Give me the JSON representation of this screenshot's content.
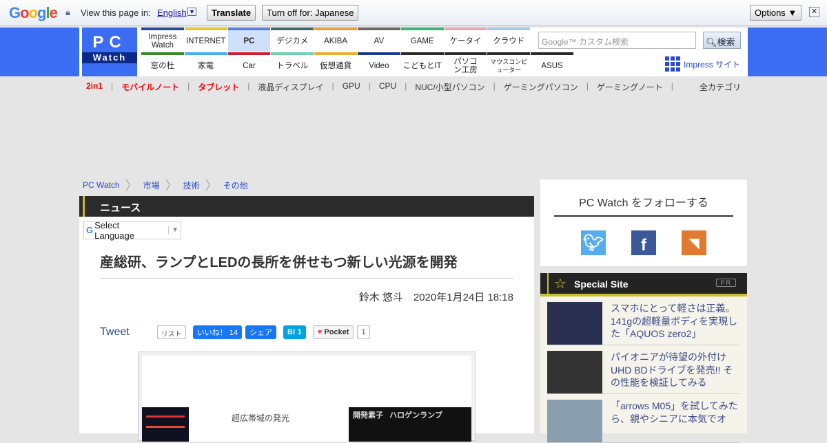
{
  "translate_bar": {
    "logo": "Google",
    "label": "View this page in:",
    "language": "English",
    "translate": "Translate",
    "turn_off": "Turn off for: Japanese",
    "options": "Options ▼",
    "close": "✕"
  },
  "logo": {
    "pc": "PC",
    "watch": "Watch"
  },
  "nav": {
    "top": [
      {
        "label": "Impress Watch",
        "color": "#2a4a9a"
      },
      {
        "label": "INTERNET",
        "color": "#e8c830"
      },
      {
        "label": "PC",
        "color": "#5a80e0"
      },
      {
        "label": "デジカメ",
        "color": "#456868"
      },
      {
        "label": "AKIBA",
        "color": "#e8a040"
      },
      {
        "label": "AV",
        "color": "#6a6a6a"
      },
      {
        "label": "GAME",
        "color": "#38b878"
      },
      {
        "label": "ケータイ",
        "color": "#e8a8b0"
      },
      {
        "label": "クラウド",
        "color": "#a8c8e8"
      }
    ],
    "bottom": [
      {
        "label": "窓の杜",
        "color": "#3a8a2a"
      },
      {
        "label": "家電",
        "color": "#48b0e8"
      },
      {
        "label": "Car",
        "color": "#d02030"
      },
      {
        "label": "トラベル",
        "color": "#70d0b0"
      },
      {
        "label": "仮想通貨",
        "color": "#e8b030"
      },
      {
        "label": "Video",
        "color": "#1a3a8a"
      },
      {
        "label": "こどもとIT",
        "color": "#2a2a2a"
      },
      {
        "label": "パソコン工房",
        "color": "#2a2a2a"
      },
      {
        "label": "マウスコンピューター",
        "color": "#2a2a2a"
      },
      {
        "label": "ASUS",
        "color": "#2a2a2a"
      }
    ]
  },
  "search": {
    "placeholder": "Google™ カスタム検索",
    "button": "検索"
  },
  "impress_site": "Impress サイト",
  "categories": [
    {
      "label": "2in1",
      "hot": true
    },
    {
      "label": "モバイルノート",
      "hot": true
    },
    {
      "label": "タブレット",
      "hot": true
    },
    {
      "label": "液晶ディスプレイ"
    },
    {
      "label": "GPU"
    },
    {
      "label": "CPU"
    },
    {
      "label": "NUC/小型パソコン"
    },
    {
      "label": "ゲーミングパソコン"
    },
    {
      "label": "ゲーミングノート"
    }
  ],
  "all_categories": "全カテゴリ",
  "breadcrumb": [
    "PC Watch",
    "市場",
    "技術",
    "その他"
  ],
  "section": "ニュース",
  "select_language": "Select Language",
  "article": {
    "title": "産総研、ランプとLEDの長所を併せもつ新しい光源を開発",
    "author": "鈴木 悠斗",
    "date": "2020年1月24日 18:18"
  },
  "social": {
    "tweet": "Tweet",
    "list": "リスト",
    "like": "いいね！ 14",
    "share": "シェア",
    "hatena": "B! 1",
    "pocket": "Pocket",
    "pocket_count": "1"
  },
  "figure": {
    "caption1": "超広帯域の発光",
    "label_dev": "開発素子",
    "label_halogen": "ハロゲンランプ"
  },
  "follow": {
    "title": "PC Watch をフォローする",
    "twitter_color": "#55acee",
    "facebook_color": "#3b5998",
    "rss_color": "#e07a30"
  },
  "special": {
    "title": "Special Site",
    "pr": "PR",
    "items": [
      "スマホにとって軽さは正義。141gの超軽量ボディを実現した「AQUOS zero2」",
      "パイオニアが待望の外付けUHD BDドライブを発売!! その性能を検証してみる",
      "「arrows M05」を試してみたら、親やシニアに本気でオ"
    ]
  }
}
